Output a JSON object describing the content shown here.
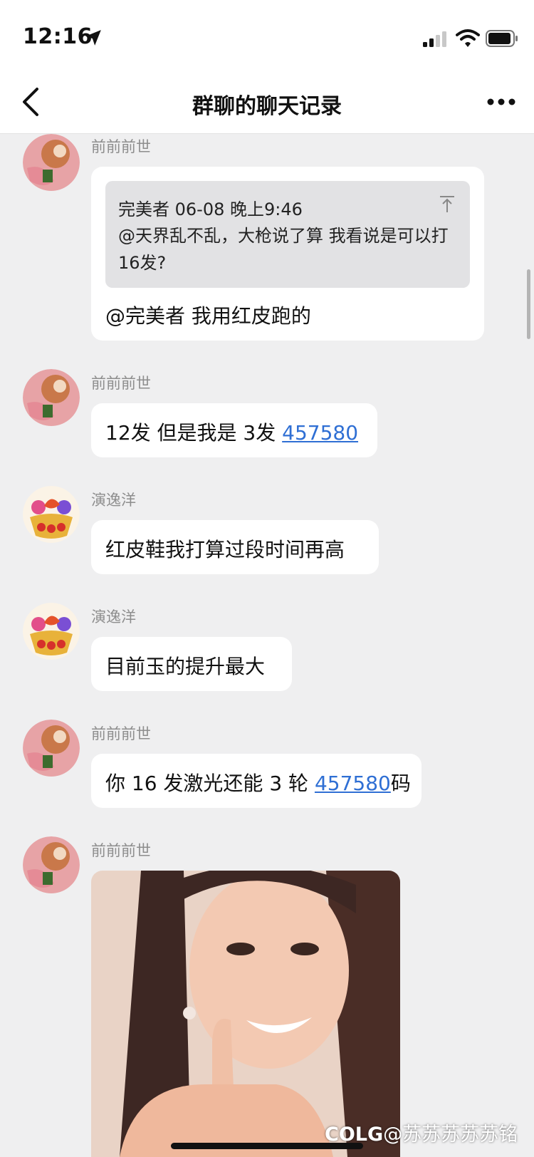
{
  "status_bar": {
    "time": "12:16"
  },
  "nav": {
    "title": "群聊的聊天记录"
  },
  "messages": [
    {
      "sender": "前前前世",
      "quote": {
        "header": "完美者 06-08 晚上9:46",
        "text": "@天界乱不乱，大枪说了算 我看说是可以打16发?"
      },
      "text": "@完美者 我用红皮跑的"
    },
    {
      "sender": "前前前世",
      "text": "12发 但是我是 3发 ",
      "link": "457580"
    },
    {
      "sender": "演逸洋",
      "text": "红皮鞋我打算过段时间再高"
    },
    {
      "sender": "演逸洋",
      "text": "目前玉的提升最大"
    },
    {
      "sender": "前前前世",
      "text": "你 16 发激光还能 3 轮 ",
      "link": "457580",
      "suffix": "码"
    },
    {
      "sender": "前前前世",
      "image": "photo-message"
    }
  ],
  "watermark": {
    "brand": "COLG",
    "handle": "@苏苏苏苏苏铭"
  }
}
